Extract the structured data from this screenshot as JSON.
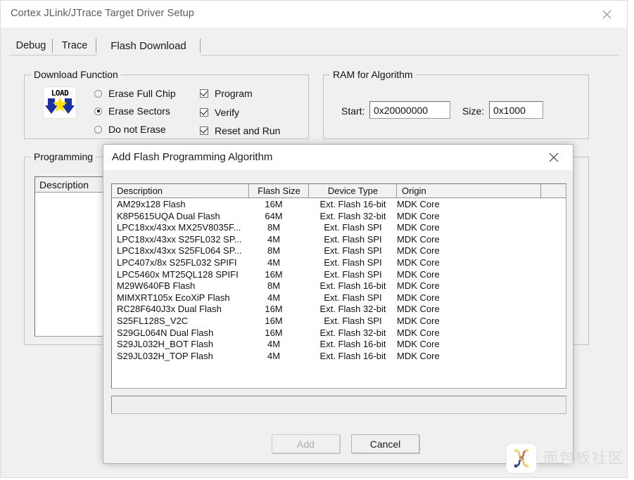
{
  "window": {
    "title": "Cortex JLink/JTrace Target Driver Setup",
    "close_icon": "close-icon"
  },
  "tabs": [
    {
      "label": "Debug",
      "active": false
    },
    {
      "label": "Trace",
      "active": false
    },
    {
      "label": "Flash Download",
      "active": true
    }
  ],
  "download_function": {
    "title": "Download Function",
    "icon_label": "LOAD",
    "radios": [
      {
        "label": "Erase Full Chip",
        "checked": false
      },
      {
        "label": "Erase Sectors",
        "checked": true
      },
      {
        "label": "Do not Erase",
        "checked": false
      }
    ],
    "checkboxes": [
      {
        "label": "Program",
        "checked": true
      },
      {
        "label": "Verify",
        "checked": true
      },
      {
        "label": "Reset and Run",
        "checked": true
      }
    ]
  },
  "ram_for_algorithm": {
    "title": "RAM for Algorithm",
    "start_label": "Start:",
    "start_value": "0x20000000",
    "size_label": "Size:",
    "size_value": "0x1000"
  },
  "programming": {
    "title": "Programming",
    "column_header": "Description",
    "rows": []
  },
  "dialog": {
    "title": "Add Flash Programming Algorithm",
    "close_icon": "close-icon",
    "columns": [
      "Description",
      "Flash Size",
      "Device Type",
      "Origin",
      ""
    ],
    "rows": [
      {
        "description": "AM29x128 Flash",
        "flash_size": "16M",
        "device_type": "Ext. Flash 16-bit",
        "origin": "MDK Core"
      },
      {
        "description": "K8P5615UQA Dual Flash",
        "flash_size": "64M",
        "device_type": "Ext. Flash 32-bit",
        "origin": "MDK Core"
      },
      {
        "description": "LPC18xx/43xx MX25V8035F...",
        "flash_size": "8M",
        "device_type": "Ext. Flash SPI",
        "origin": "MDK Core"
      },
      {
        "description": "LPC18xx/43xx S25FL032 SP...",
        "flash_size": "4M",
        "device_type": "Ext. Flash SPI",
        "origin": "MDK Core"
      },
      {
        "description": "LPC18xx/43xx S25FL064 SP...",
        "flash_size": "8M",
        "device_type": "Ext. Flash SPI",
        "origin": "MDK Core"
      },
      {
        "description": "LPC407x/8x S25FL032 SPIFI",
        "flash_size": "4M",
        "device_type": "Ext. Flash SPI",
        "origin": "MDK Core"
      },
      {
        "description": "LPC5460x MT25QL128 SPIFI",
        "flash_size": "16M",
        "device_type": "Ext. Flash SPI",
        "origin": "MDK Core"
      },
      {
        "description": "M29W640FB Flash",
        "flash_size": "8M",
        "device_type": "Ext. Flash 16-bit",
        "origin": "MDK Core"
      },
      {
        "description": "MIMXRT105x EcoXiP Flash",
        "flash_size": "4M",
        "device_type": "Ext. Flash SPI",
        "origin": "MDK Core"
      },
      {
        "description": "RC28F640J3x Dual Flash",
        "flash_size": "16M",
        "device_type": "Ext. Flash 32-bit",
        "origin": "MDK Core"
      },
      {
        "description": "S25FL128S_V2C",
        "flash_size": "16M",
        "device_type": "Ext. Flash SPI",
        "origin": "MDK Core"
      },
      {
        "description": "S29GL064N Dual Flash",
        "flash_size": "16M",
        "device_type": "Ext. Flash 32-bit",
        "origin": "MDK Core"
      },
      {
        "description": "S29JL032H_BOT Flash",
        "flash_size": "4M",
        "device_type": "Ext. Flash 16-bit",
        "origin": "MDK Core"
      },
      {
        "description": "S29JL032H_TOP Flash",
        "flash_size": "4M",
        "device_type": "Ext. Flash 16-bit",
        "origin": "MDK Core"
      }
    ],
    "filter_value": "",
    "add_label": "Add",
    "add_enabled": false,
    "cancel_label": "Cancel"
  },
  "watermark": {
    "text": "面包板社区",
    "subtext": "www.eet-china.com"
  },
  "colors": {
    "window_bg": "#f0f0f0",
    "titlebar_bg": "#ffffff",
    "field_bg": "#ffffff",
    "border": "#c2c2c2",
    "text": "#111111",
    "title_text": "#5c5c5c",
    "disabled_text": "#adadad",
    "icon_yellow": "#ffe000",
    "icon_blue": "#1a2fa0"
  }
}
